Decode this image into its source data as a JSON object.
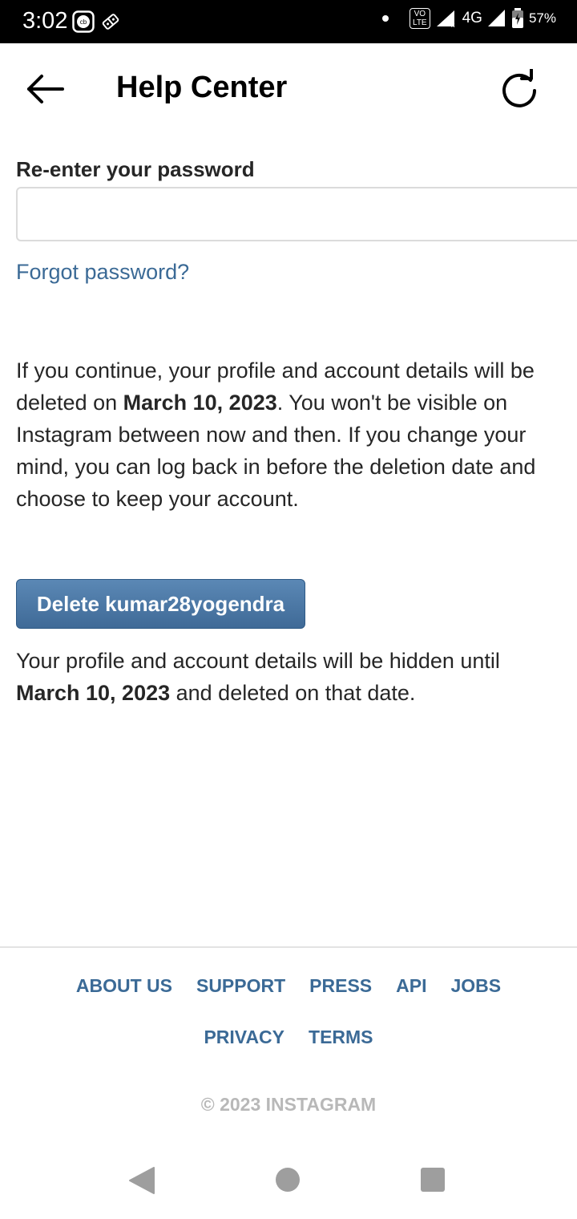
{
  "status_bar": {
    "time": "3:02",
    "network": "4G",
    "volte": "VoLTE",
    "battery": "57%"
  },
  "header": {
    "title": "Help Center"
  },
  "form": {
    "password_label": "Re-enter your password",
    "password_value": "",
    "forgot_link": "Forgot password?"
  },
  "info": {
    "p1_before": "If you continue, your profile and account details will be deleted on ",
    "p1_date": "March 10, 2023",
    "p1_after": ". You won't be visible on Instagram between now and then. If you change your mind, you can log back in before the deletion date and choose to keep your account.",
    "delete_button": "Delete kumar28yogendra",
    "p2_before": "Your profile and account details will be hidden until ",
    "p2_date": "March 10, 2023",
    "p2_after": " and deleted on that date."
  },
  "footer": {
    "links_row1": [
      "ABOUT US",
      "SUPPORT",
      "PRESS",
      "API",
      "JOBS"
    ],
    "links_row2": [
      "PRIVACY",
      "TERMS"
    ],
    "copyright": "© 2023 INSTAGRAM"
  },
  "colors": {
    "link": "#3b6a96",
    "button": "#4a77a5",
    "status_bar": "#000000"
  }
}
